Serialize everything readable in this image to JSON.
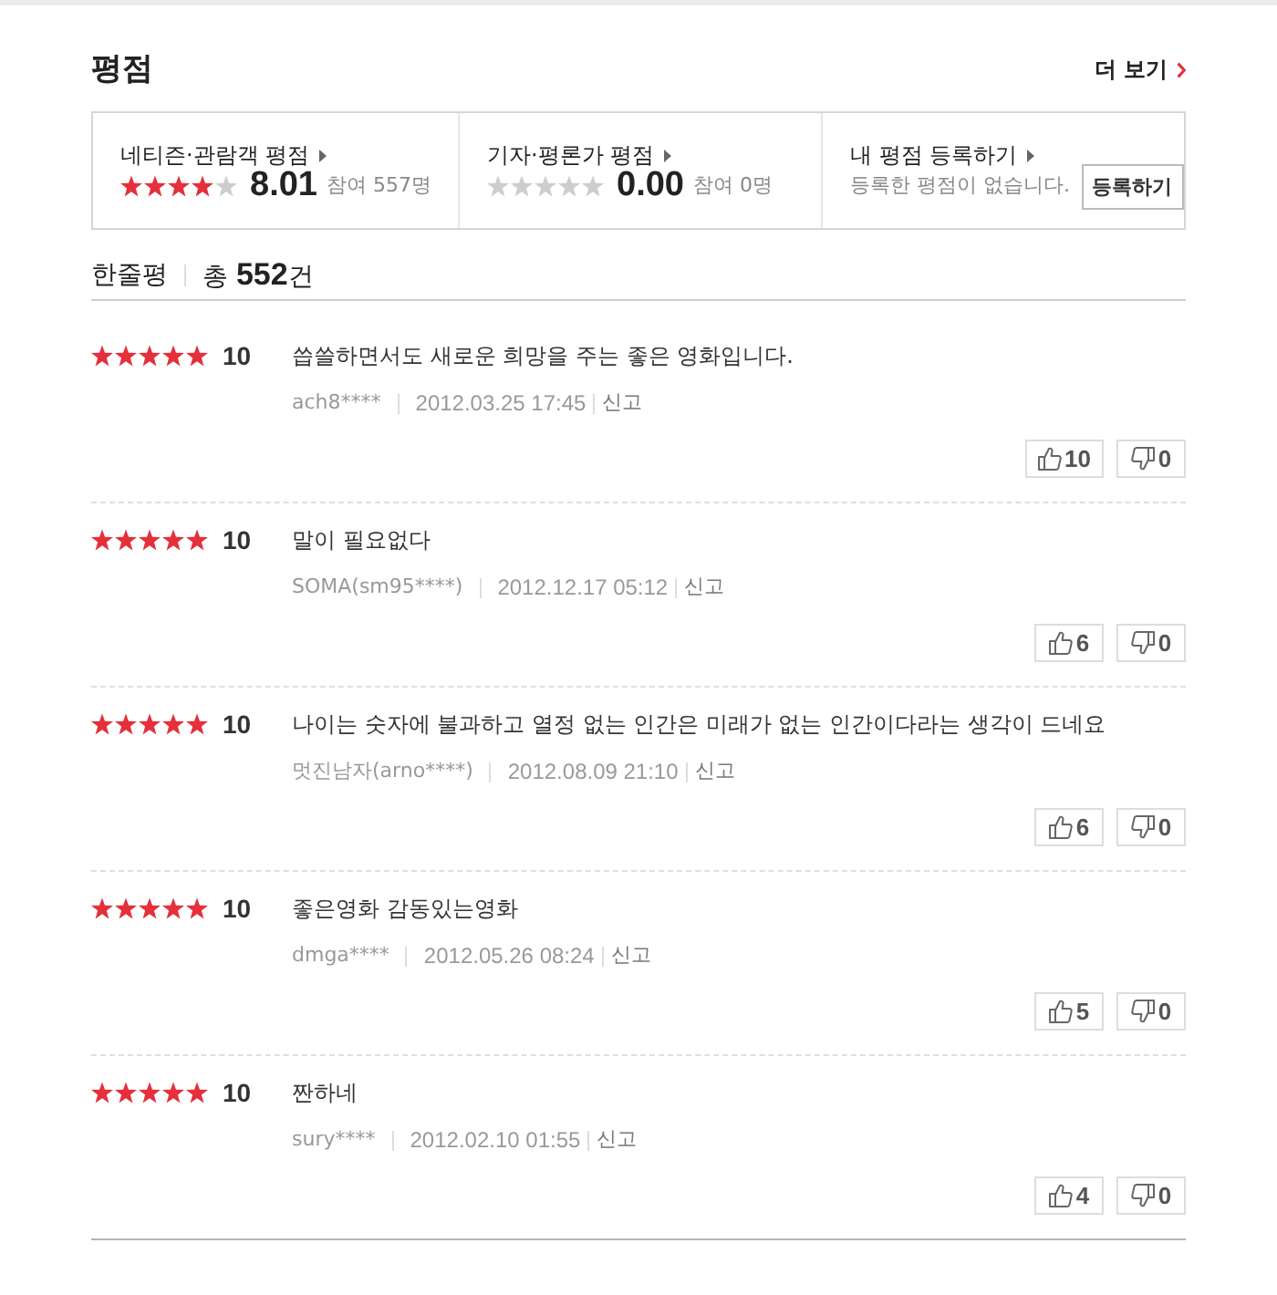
{
  "section": {
    "title": "평점",
    "more_link": "더 보기"
  },
  "summary": [
    {
      "kind": "rating",
      "label": "네티즌·관람객 평점",
      "stars": 4,
      "score": "8.01",
      "participants": "참여 557명"
    },
    {
      "kind": "rating",
      "label": "기자·평론가 평점",
      "stars": 0,
      "score": "0.00",
      "participants": "참여 0명"
    },
    {
      "kind": "register",
      "label": "내 평점 등록하기",
      "message": "등록한 평점이 없습니다.",
      "button": "등록하기"
    }
  ],
  "reviews_header": {
    "title": "한줄평",
    "total": "총 **552**건"
  },
  "reviews": [
    {
      "stars": 5,
      "score": "10",
      "text": "씁쓸하면서도 새로운 희망을 주는 좋은 영화입니다.",
      "author": "ach8****",
      "date": "2012.03.25 17:45",
      "report": "신고",
      "likes": "10",
      "dislikes": "0"
    },
    {
      "stars": 5,
      "score": "10",
      "text": "말이 필요없다",
      "author": "SOMA(sm95****)",
      "date": "2012.12.17 05:12",
      "report": "신고",
      "likes": "6",
      "dislikes": "0"
    },
    {
      "stars": 5,
      "score": "10",
      "text": "나이는 숫자에 불과하고 열정 없는 인간은 미래가 없는 인간이다라는 생각이 드네요",
      "author": "멋진남자(arno****)",
      "date": "2012.08.09 21:10",
      "report": "신고",
      "likes": "6",
      "dislikes": "0"
    },
    {
      "stars": 5,
      "score": "10",
      "text": "좋은영화 감동있는영화",
      "author": "dmga****",
      "date": "2012.05.26 08:24",
      "report": "신고",
      "likes": "5",
      "dislikes": "0"
    },
    {
      "stars": 5,
      "score": "10",
      "text": "짠하네",
      "author": "sury****",
      "date": "2012.02.10 01:55",
      "report": "신고",
      "likes": "4",
      "dislikes": "0"
    }
  ]
}
